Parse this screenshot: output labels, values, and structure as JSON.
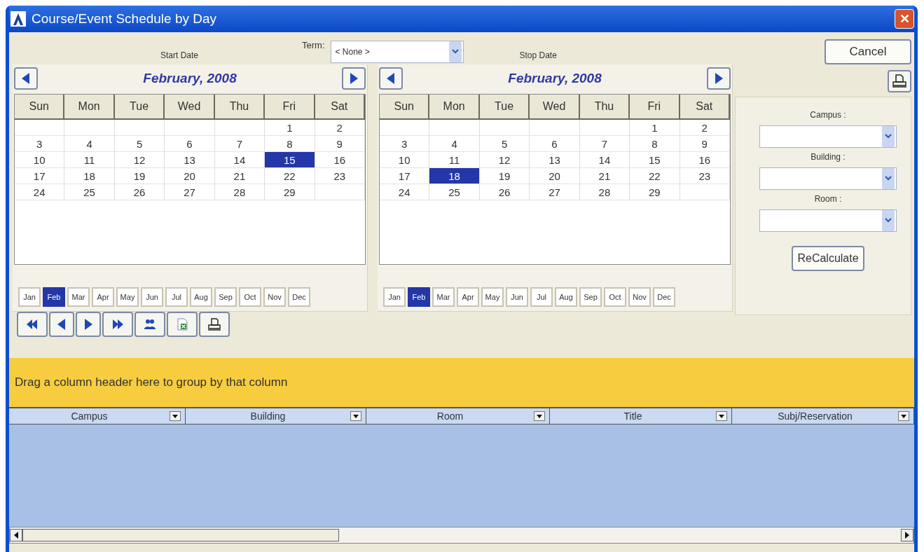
{
  "window": {
    "title": "Course/Event Schedule by Day",
    "close_label": "✕"
  },
  "term": {
    "label": "Term:",
    "value": "< None >"
  },
  "calendars": [
    {
      "caption": "Start Date",
      "month_title": "February, 2008",
      "weekdays": [
        "Sun",
        "Mon",
        "Tue",
        "Wed",
        "Thu",
        "Fri",
        "Sat"
      ],
      "weeks": [
        [
          {
            "kind": "empty"
          },
          {
            "kind": "empty"
          },
          {
            "kind": "empty"
          },
          {
            "kind": "empty"
          },
          {
            "kind": "empty"
          },
          {
            "kind": "day",
            "day": "1",
            "selected": false
          },
          {
            "kind": "day",
            "day": "2",
            "selected": false
          }
        ],
        [
          {
            "kind": "day",
            "day": "3",
            "selected": false
          },
          {
            "kind": "day",
            "day": "4",
            "selected": false
          },
          {
            "kind": "day",
            "day": "5",
            "selected": false
          },
          {
            "kind": "day",
            "day": "6",
            "selected": false
          },
          {
            "kind": "day",
            "day": "7",
            "selected": false
          },
          {
            "kind": "day",
            "day": "8",
            "selected": false
          },
          {
            "kind": "day",
            "day": "9",
            "selected": false
          }
        ],
        [
          {
            "kind": "day",
            "day": "10",
            "selected": false
          },
          {
            "kind": "day",
            "day": "11",
            "selected": false
          },
          {
            "kind": "day",
            "day": "12",
            "selected": false
          },
          {
            "kind": "day",
            "day": "13",
            "selected": false
          },
          {
            "kind": "day",
            "day": "14",
            "selected": false
          },
          {
            "kind": "day",
            "day": "15",
            "selected": true
          },
          {
            "kind": "day",
            "day": "16",
            "selected": false
          }
        ],
        [
          {
            "kind": "day",
            "day": "17",
            "selected": false
          },
          {
            "kind": "day",
            "day": "18",
            "selected": false
          },
          {
            "kind": "day",
            "day": "19",
            "selected": false
          },
          {
            "kind": "day",
            "day": "20",
            "selected": false
          },
          {
            "kind": "day",
            "day": "21",
            "selected": false
          },
          {
            "kind": "day",
            "day": "22",
            "selected": false
          },
          {
            "kind": "day",
            "day": "23",
            "selected": false
          }
        ],
        [
          {
            "kind": "day",
            "day": "24",
            "selected": false
          },
          {
            "kind": "day",
            "day": "25",
            "selected": false
          },
          {
            "kind": "day",
            "day": "26",
            "selected": false
          },
          {
            "kind": "day",
            "day": "27",
            "selected": false
          },
          {
            "kind": "day",
            "day": "28",
            "selected": false
          },
          {
            "kind": "day",
            "day": "29",
            "selected": false
          },
          {
            "kind": "empty"
          }
        ]
      ],
      "months": [
        {
          "label": "Jan",
          "selected": false
        },
        {
          "label": "Feb",
          "selected": true
        },
        {
          "label": "Mar",
          "selected": false
        },
        {
          "label": "Apr",
          "selected": false
        },
        {
          "label": "May",
          "selected": false
        },
        {
          "label": "Jun",
          "selected": false
        },
        {
          "label": "Jul",
          "selected": false
        },
        {
          "label": "Aug",
          "selected": false
        },
        {
          "label": "Sep",
          "selected": false
        },
        {
          "label": "Oct",
          "selected": false
        },
        {
          "label": "Nov",
          "selected": false
        },
        {
          "label": "Dec",
          "selected": false
        }
      ]
    },
    {
      "caption": "Stop Date",
      "month_title": "February, 2008",
      "weekdays": [
        "Sun",
        "Mon",
        "Tue",
        "Wed",
        "Thu",
        "Fri",
        "Sat"
      ],
      "weeks": [
        [
          {
            "kind": "empty"
          },
          {
            "kind": "empty"
          },
          {
            "kind": "empty"
          },
          {
            "kind": "empty"
          },
          {
            "kind": "empty"
          },
          {
            "kind": "day",
            "day": "1",
            "selected": false
          },
          {
            "kind": "day",
            "day": "2",
            "selected": false
          }
        ],
        [
          {
            "kind": "day",
            "day": "3",
            "selected": false
          },
          {
            "kind": "day",
            "day": "4",
            "selected": false
          },
          {
            "kind": "day",
            "day": "5",
            "selected": false
          },
          {
            "kind": "day",
            "day": "6",
            "selected": false
          },
          {
            "kind": "day",
            "day": "7",
            "selected": false
          },
          {
            "kind": "day",
            "day": "8",
            "selected": false
          },
          {
            "kind": "day",
            "day": "9",
            "selected": false
          }
        ],
        [
          {
            "kind": "day",
            "day": "10",
            "selected": false
          },
          {
            "kind": "day",
            "day": "11",
            "selected": false
          },
          {
            "kind": "day",
            "day": "12",
            "selected": false
          },
          {
            "kind": "day",
            "day": "13",
            "selected": false
          },
          {
            "kind": "day",
            "day": "14",
            "selected": false
          },
          {
            "kind": "day",
            "day": "15",
            "selected": false
          },
          {
            "kind": "day",
            "day": "16",
            "selected": false
          }
        ],
        [
          {
            "kind": "day",
            "day": "17",
            "selected": false
          },
          {
            "kind": "day",
            "day": "18",
            "selected": true
          },
          {
            "kind": "day",
            "day": "19",
            "selected": false
          },
          {
            "kind": "day",
            "day": "20",
            "selected": false
          },
          {
            "kind": "day",
            "day": "21",
            "selected": false
          },
          {
            "kind": "day",
            "day": "22",
            "selected": false
          },
          {
            "kind": "day",
            "day": "23",
            "selected": false
          }
        ],
        [
          {
            "kind": "day",
            "day": "24",
            "selected": false
          },
          {
            "kind": "day",
            "day": "25",
            "selected": false
          },
          {
            "kind": "day",
            "day": "26",
            "selected": false
          },
          {
            "kind": "day",
            "day": "27",
            "selected": false
          },
          {
            "kind": "day",
            "day": "28",
            "selected": false
          },
          {
            "kind": "day",
            "day": "29",
            "selected": false
          },
          {
            "kind": "empty"
          }
        ]
      ],
      "months": [
        {
          "label": "Jan",
          "selected": false
        },
        {
          "label": "Feb",
          "selected": true
        },
        {
          "label": "Mar",
          "selected": false
        },
        {
          "label": "Apr",
          "selected": false
        },
        {
          "label": "May",
          "selected": false
        },
        {
          "label": "Jun",
          "selected": false
        },
        {
          "label": "Jul",
          "selected": false
        },
        {
          "label": "Aug",
          "selected": false
        },
        {
          "label": "Sep",
          "selected": false
        },
        {
          "label": "Oct",
          "selected": false
        },
        {
          "label": "Nov",
          "selected": false
        },
        {
          "label": "Dec",
          "selected": false
        }
      ]
    }
  ],
  "cancel_button": "Cancel",
  "filters": [
    {
      "label": "Campus :"
    },
    {
      "label": "Building :"
    },
    {
      "label": "Room :"
    }
  ],
  "recalculate_button": "ReCalculate",
  "group_panel": {
    "text": "Drag a column header here to group by that column"
  },
  "grid": {
    "columns": [
      "Campus",
      "Building",
      "Room",
      "Title",
      "Subj/Reservation"
    ]
  }
}
